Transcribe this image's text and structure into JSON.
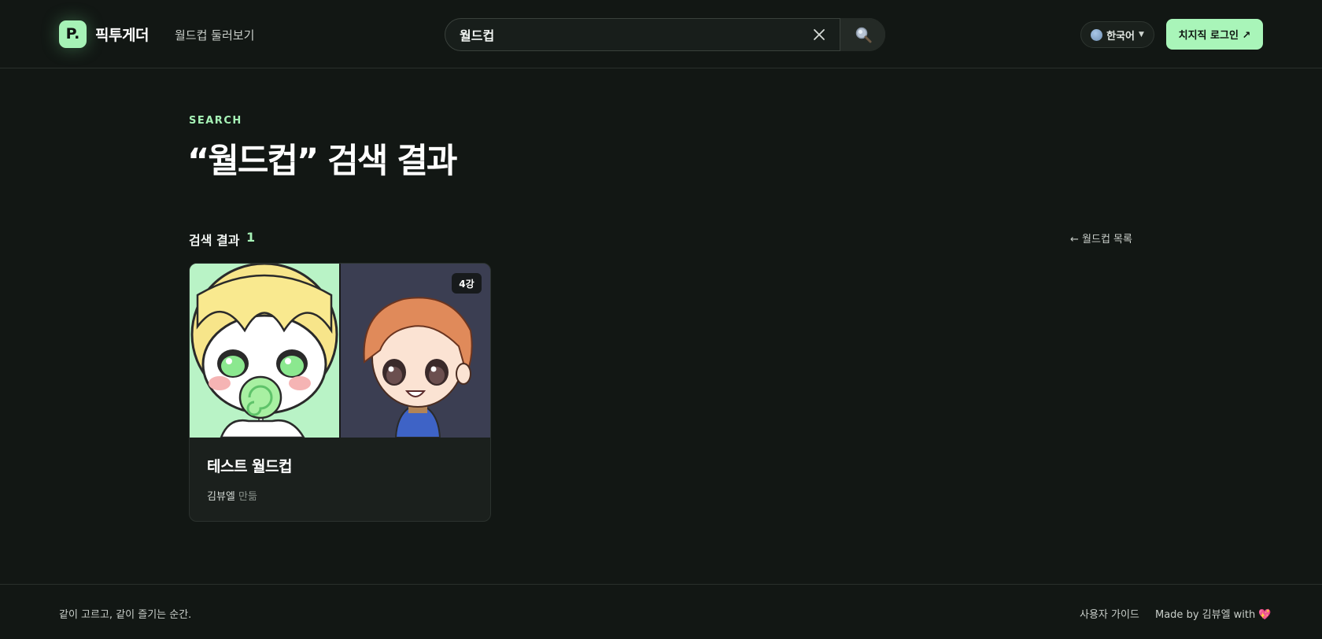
{
  "header": {
    "logo_glyph": "P.",
    "logo_text": "픽투게더",
    "nav_browse": "월드컵 둘러보기",
    "search": {
      "value": "월드컵"
    },
    "language": "한국어",
    "login_label": "치지직 로그인 ↗"
  },
  "main": {
    "eyebrow": "SEARCH",
    "title": "“월드컵” 검색 결과",
    "result_label": "검색 결과",
    "result_count": "1",
    "back_link": "← 월드컵 목록",
    "cards": [
      {
        "rounds": "4강",
        "title": "테스트 월드컵",
        "author": "김뷰엘",
        "author_suffix": "만듦"
      }
    ]
  },
  "footer": {
    "tagline": "같이 고르고, 같이 즐기는 순간.",
    "guide": "사용자 가이드",
    "credit": "Made by 김뷰엘 with 💖"
  },
  "colors": {
    "background": "#121714",
    "accent": "#a6f2b6",
    "card": "#1b201d"
  }
}
